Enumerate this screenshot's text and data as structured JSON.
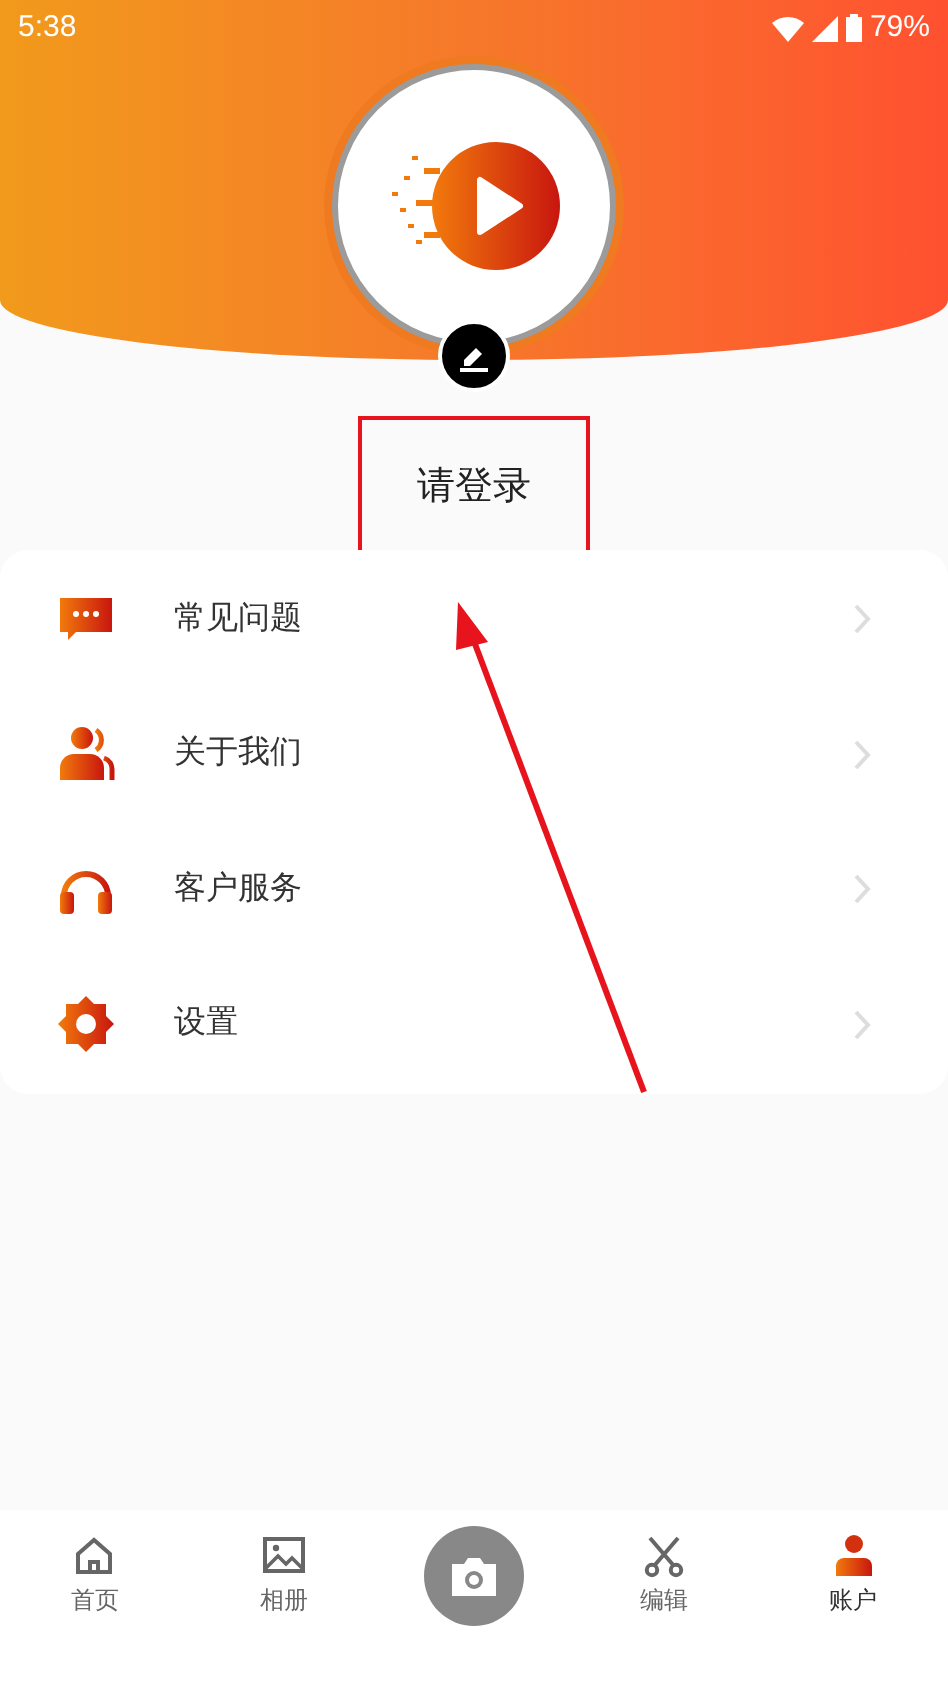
{
  "status_bar": {
    "time": "5:38",
    "battery": "79%"
  },
  "profile": {
    "login_prompt": "请登录"
  },
  "menu": [
    {
      "label": "常见问题",
      "kind": "faq"
    },
    {
      "label": "关于我们",
      "kind": "about"
    },
    {
      "label": "客户服务",
      "kind": "service"
    },
    {
      "label": "设置",
      "kind": "settings"
    }
  ],
  "tabs": [
    {
      "label": "首页",
      "kind": "home",
      "selected": false
    },
    {
      "label": "相册",
      "kind": "album",
      "selected": false
    },
    {
      "kind": "camera",
      "selected": false
    },
    {
      "label": "编辑",
      "kind": "edit",
      "selected": false
    },
    {
      "label": "账户",
      "kind": "account",
      "selected": true
    }
  ]
}
